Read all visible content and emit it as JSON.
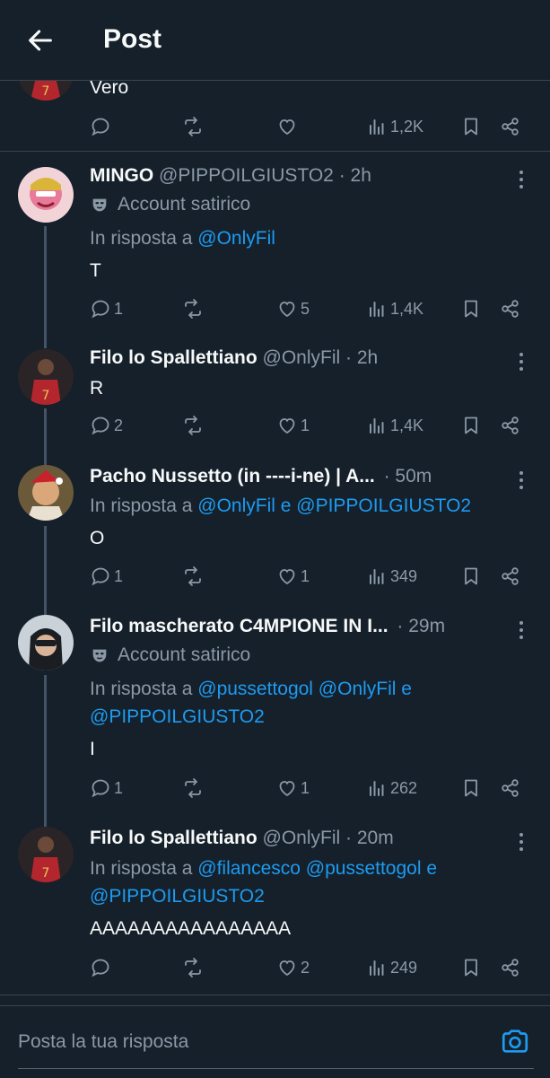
{
  "header": {
    "title": "Post"
  },
  "parent_tail": {
    "text": "Vero",
    "views": "1,2K"
  },
  "tweets": [
    {
      "name": "MINGO",
      "handle": "@PIPPOILGIUSTO2",
      "time": "· 2h",
      "satire_label": "Account satirico",
      "reply_prefix": "In risposta a",
      "reply_line1": "@OnlyFil",
      "text": "T",
      "replies": "1",
      "likes": "5",
      "views": "1,4K"
    },
    {
      "name": "Filo lo Spallettiano",
      "handle": "@OnlyFil",
      "time": "· 2h",
      "text": "R",
      "replies": "2",
      "likes": "1",
      "views": "1,4K"
    },
    {
      "name": "Pacho Nussetto (in ----i-ne) | A...",
      "time": "· 50m",
      "reply_prefix": "In risposta a",
      "reply_line1": "@OnlyFil e @PIPPOILGIUSTO2",
      "text": "O",
      "replies": "1",
      "likes": "1",
      "views": "349"
    },
    {
      "name": "Filo mascherato C4MPIONE IN I...",
      "time": "· 29m",
      "satire_label": "Account satirico",
      "reply_prefix": "In risposta a",
      "reply_line1": "@pussettogol @OnlyFil e",
      "reply_line2": "@PIPPOILGIUSTO2",
      "text": "I",
      "replies": "1",
      "likes": "1",
      "views": "262"
    },
    {
      "name": "Filo lo Spallettiano",
      "handle": "@OnlyFil",
      "time": "· 20m",
      "reply_prefix": "In risposta a",
      "reply_line1": "@filancesco @pussettogol e",
      "reply_line2": "@PIPPOILGIUSTO2",
      "text": "AAAAAAAAAAAAAAAA",
      "likes": "2",
      "views": "249"
    }
  ],
  "composer": {
    "placeholder": "Posta la tua risposta"
  },
  "colors": {
    "background": "#15202b",
    "accent": "#1d9bf0",
    "muted": "#8b98a5",
    "divider": "#38444d"
  }
}
